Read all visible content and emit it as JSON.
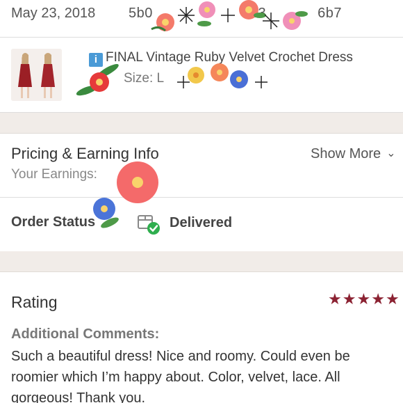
{
  "order": {
    "date": "May 23, 2018",
    "id_prefix": "5b0",
    "id_middle": "23",
    "id_suffix": "6b7"
  },
  "item": {
    "info_icon": "i",
    "title": "FINAL Vintage Ruby Velvet Crochet Dress",
    "size": "Size: L"
  },
  "pricing": {
    "title": "Pricing & Earning Info",
    "show_more": "Show More",
    "earnings_label": "Your Earnings:"
  },
  "status": {
    "label": "Order Status",
    "value": "Delivered",
    "icon": "package-check-icon",
    "accent": "#2fae4e"
  },
  "rating": {
    "title": "Rating",
    "stars": 5,
    "star_color": "#8b2232",
    "comments_label": "Additional Comments:",
    "comments": "Such a beautiful dress! Nice and roomy. Could even be roomier which I’m happy about. Color, velvet, lace. All gorgeous! Thank you."
  }
}
